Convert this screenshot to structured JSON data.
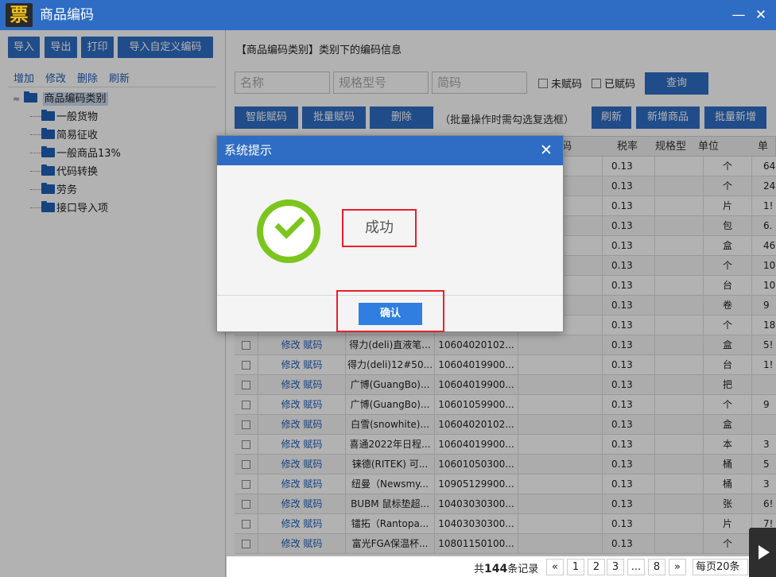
{
  "window": {
    "logo_char": "票",
    "title": "商品编码",
    "minimize": "—",
    "close": "✕"
  },
  "left_toolbar": [
    "导入",
    "导出",
    "打印",
    "导入自定义编码"
  ],
  "left_links": [
    "增加",
    "修改",
    "删除",
    "刷新"
  ],
  "tree": {
    "expand_glyph": "≈",
    "root": "商品编码类别",
    "children": [
      "一般货物",
      "简易征收",
      "一般商品13%",
      "代码转换",
      "劳务",
      "接口导入项"
    ]
  },
  "section_title": "【商品编码类别】类别下的编码信息",
  "filters": {
    "name_placeholder": "名称",
    "spec_placeholder": "规格型号",
    "short_placeholder": "简码",
    "uncoded": "未赋码",
    "coded": "已赋码",
    "query": "查询"
  },
  "actions": {
    "smart": "智能赋码",
    "batch": "批量赋码",
    "delete": "删除",
    "hint": "（批量操作时需勾选复选框）",
    "refresh": "刷新",
    "add": "新增商品",
    "batch_add": "批量新增"
  },
  "table_headers": {
    "code": "码",
    "tax": "税率",
    "spec": "规格型",
    "unit": "单位",
    "price": "单"
  },
  "row_links": {
    "edit": "修改",
    "assign": "赋码"
  },
  "rows_upper": [
    {
      "tax": "0.13",
      "unit": "个",
      "price": "64"
    },
    {
      "tax": "0.13",
      "unit": "个",
      "price": "24"
    },
    {
      "tax": "0.13",
      "unit": "片",
      "price": "1!"
    },
    {
      "tax": "0.13",
      "unit": "包",
      "price": "6."
    },
    {
      "tax": "0.13",
      "unit": "盒",
      "price": "46"
    },
    {
      "tax": "0.13",
      "unit": "个",
      "price": "10"
    },
    {
      "tax": "0.13",
      "unit": "台",
      "price": "10"
    },
    {
      "tax": "0.13",
      "unit": "卷",
      "price": "9"
    },
    {
      "tax": "0.13",
      "unit": "个",
      "price": "18"
    }
  ],
  "rows_lower": [
    {
      "name": "得力(deli)直液笔...",
      "code": "10604020102...",
      "tax": "0.13",
      "unit": "盒",
      "price": "5!"
    },
    {
      "name": "得力(deli)12#50...",
      "code": "10604019900...",
      "tax": "0.13",
      "unit": "台",
      "price": "1!"
    },
    {
      "name": "广博(GuangBo)...",
      "code": "10604019900...",
      "tax": "0.13",
      "unit": "把",
      "price": ""
    },
    {
      "name": "广博(GuangBo)...",
      "code": "10601059900...",
      "tax": "0.13",
      "unit": "个",
      "price": "9"
    },
    {
      "name": "白雪(snowhite)...",
      "code": "10604020102...",
      "tax": "0.13",
      "unit": "盒",
      "price": ""
    },
    {
      "name": "喜通2022年日程...",
      "code": "10604019900...",
      "tax": "0.13",
      "unit": "本",
      "price": "3"
    },
    {
      "name": "铼德(RITEK) 可...",
      "code": "10601050300...",
      "tax": "0.13",
      "unit": "桶",
      "price": "5"
    },
    {
      "name": "纽曼（Newsmy...",
      "code": "10905129900...",
      "tax": "0.13",
      "unit": "桶",
      "price": "3"
    },
    {
      "name": "BUBM 鼠标垫超...",
      "code": "10403030300...",
      "tax": "0.13",
      "unit": "张",
      "price": "6!"
    },
    {
      "name": "镭拓（Rantopa...",
      "code": "10403030300...",
      "tax": "0.13",
      "unit": "片",
      "price": "7!"
    },
    {
      "name": "富光FGA保温杯...",
      "code": "10801150100...",
      "tax": "0.13",
      "unit": "个",
      "price": ""
    }
  ],
  "pagination": {
    "prefix": "共",
    "total": "144",
    "suffix": "条记录",
    "prev": "«",
    "pages": [
      "1",
      "2",
      "3",
      "...",
      "8"
    ],
    "next": "»",
    "per_page": "每页20条"
  },
  "dialog": {
    "title": "系统提示",
    "close": "✕",
    "message": "成功",
    "ok": "确认"
  },
  "colors": {
    "accent": "#2f6dc4",
    "success": "#7cc51e",
    "highlight": "#e8202a"
  }
}
